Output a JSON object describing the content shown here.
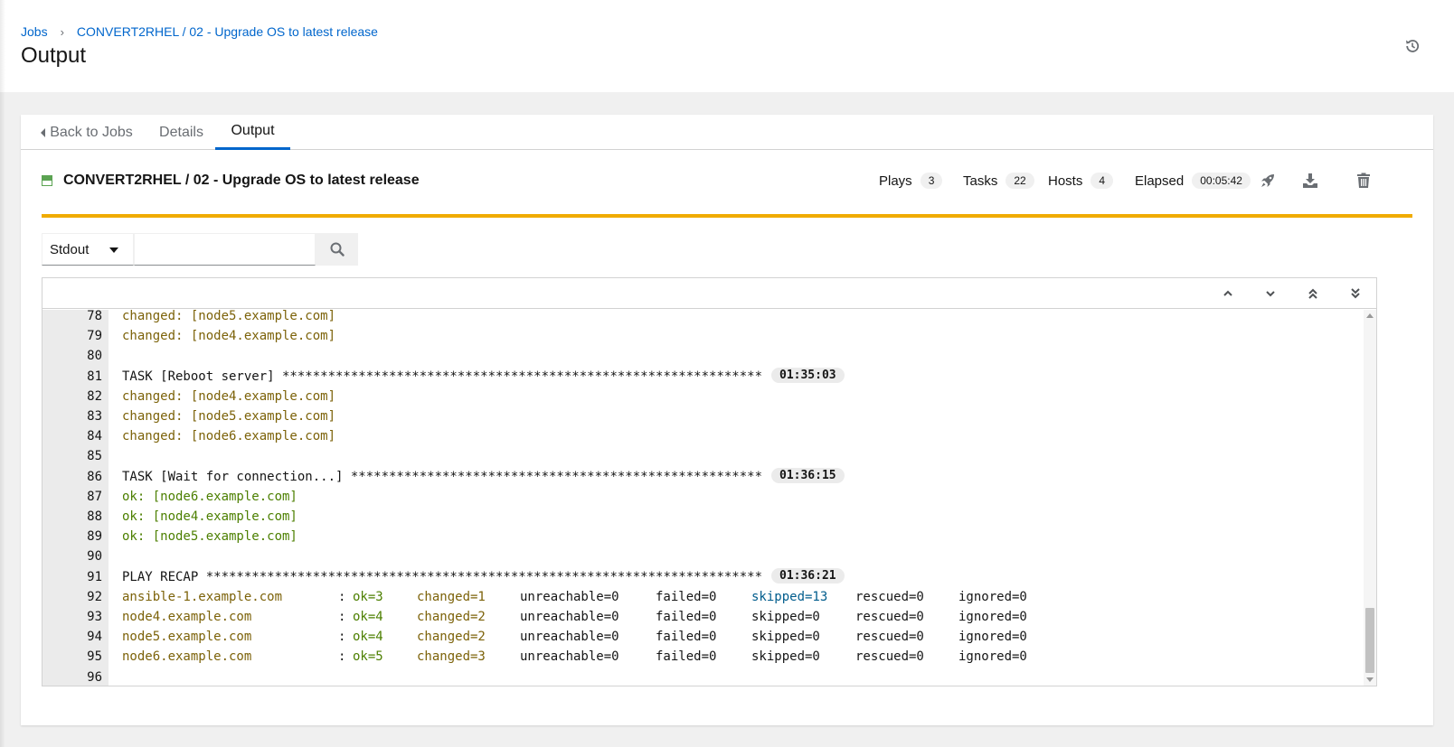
{
  "breadcrumb": {
    "jobs": "Jobs",
    "separator": "›",
    "job": "CONVERT2RHEL / 02 - Upgrade OS to latest release"
  },
  "page_title": "Output",
  "header_icons": {
    "history": "history-icon"
  },
  "tabs": {
    "back": "Back to Jobs",
    "details": "Details",
    "output": "Output"
  },
  "job": {
    "status": "running",
    "title": "CONVERT2RHEL / 02 - Upgrade OS to latest release",
    "stats": {
      "plays_label": "Plays",
      "plays": "3",
      "tasks_label": "Tasks",
      "tasks": "22",
      "hosts_label": "Hosts",
      "hosts": "4",
      "elapsed_label": "Elapsed",
      "elapsed": "00:05:42"
    },
    "actions": [
      "rocket-icon",
      "download-icon",
      "trash-icon"
    ],
    "status_color": "#f0ab00"
  },
  "filter": {
    "selected": "Stdout",
    "search_value": "",
    "search_icon": "search-icon"
  },
  "output_nav": [
    "angle-up-icon",
    "angle-down-icon",
    "angle-double-up-icon",
    "angle-double-down-icon"
  ],
  "log": {
    "colors": {
      "changed": "#7c6209",
      "ok": "#4c7f00",
      "skipped": "#005c8c",
      "plain": "#151515"
    },
    "lines": [
      {
        "num": "78",
        "text": "changed: [node5.example.com]"
      },
      {
        "num": "79",
        "text": "changed: [node4.example.com]"
      },
      {
        "num": "80",
        "text": ""
      },
      {
        "num": "81",
        "text": "TASK [Reboot server] ***************************************************************",
        "time": "01:35:03"
      },
      {
        "num": "82",
        "text": "changed: [node4.example.com]"
      },
      {
        "num": "83",
        "text": "changed: [node5.example.com]"
      },
      {
        "num": "84",
        "text": "changed: [node6.example.com]"
      },
      {
        "num": "85",
        "text": ""
      },
      {
        "num": "86",
        "text": "TASK [Wait for connection...] ******************************************************",
        "time": "01:36:15"
      },
      {
        "num": "87",
        "text": "ok: [node6.example.com]"
      },
      {
        "num": "88",
        "text": "ok: [node4.example.com]"
      },
      {
        "num": "89",
        "text": "ok: [node5.example.com]"
      },
      {
        "num": "90",
        "text": ""
      },
      {
        "num": "91",
        "text": "PLAY RECAP *************************************************************************",
        "time": "01:36:21"
      }
    ],
    "recap": [
      {
        "num": "92",
        "host": "ansible-1.example.com",
        "sep": ":",
        "ok": "ok=3",
        "changed": "changed=1",
        "unreachable": "unreachable=0",
        "failed": "failed=0",
        "skipped": "skipped=13",
        "rescued": "rescued=0",
        "ignored": "ignored=0"
      },
      {
        "num": "93",
        "host": "node4.example.com",
        "sep": ":",
        "ok": "ok=4",
        "changed": "changed=2",
        "unreachable": "unreachable=0",
        "failed": "failed=0",
        "skipped": "skipped=0",
        "rescued": "rescued=0",
        "ignored": "ignored=0"
      },
      {
        "num": "94",
        "host": "node5.example.com",
        "sep": ":",
        "ok": "ok=4",
        "changed": "changed=2",
        "unreachable": "unreachable=0",
        "failed": "failed=0",
        "skipped": "skipped=0",
        "rescued": "rescued=0",
        "ignored": "ignored=0"
      },
      {
        "num": "95",
        "host": "node6.example.com",
        "sep": ":",
        "ok": "ok=5",
        "changed": "changed=3",
        "unreachable": "unreachable=0",
        "failed": "failed=0",
        "skipped": "skipped=0",
        "rescued": "rescued=0",
        "ignored": "ignored=0"
      }
    ],
    "last_line": "96"
  }
}
